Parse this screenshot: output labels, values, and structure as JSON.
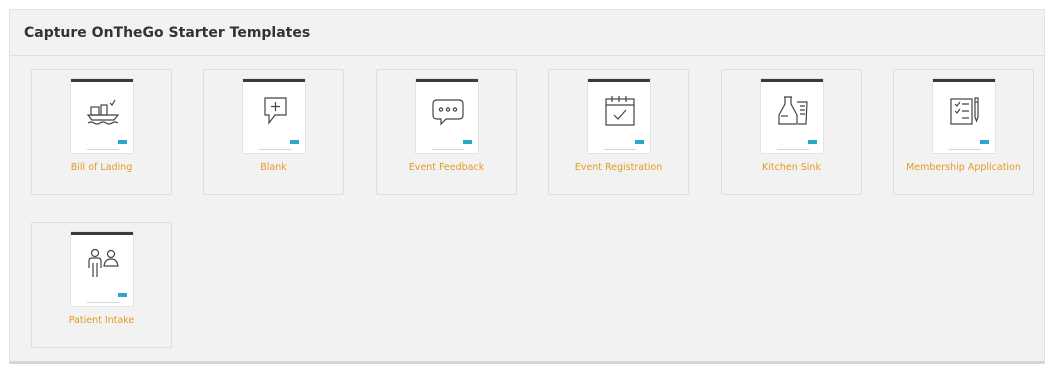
{
  "panel": {
    "title": "Capture OnTheGo Starter Templates"
  },
  "templates": [
    {
      "label": "Bill of Lading",
      "icon": "ship-icon"
    },
    {
      "label": "Blank",
      "icon": "comment-plus-icon"
    },
    {
      "label": "Event Feedback",
      "icon": "chat-bubble-icon"
    },
    {
      "label": "Event Registration",
      "icon": "calendar-check-icon"
    },
    {
      "label": "Kitchen Sink",
      "icon": "vase-icon"
    },
    {
      "label": "Membership Application",
      "icon": "clipboard-pen-icon"
    },
    {
      "label": "Patient Intake",
      "icon": "patient-icon"
    }
  ],
  "colors": {
    "label": "#e39b1f",
    "thumb_button": "#2aa7c9",
    "panel_bg": "#f2f2f2"
  }
}
